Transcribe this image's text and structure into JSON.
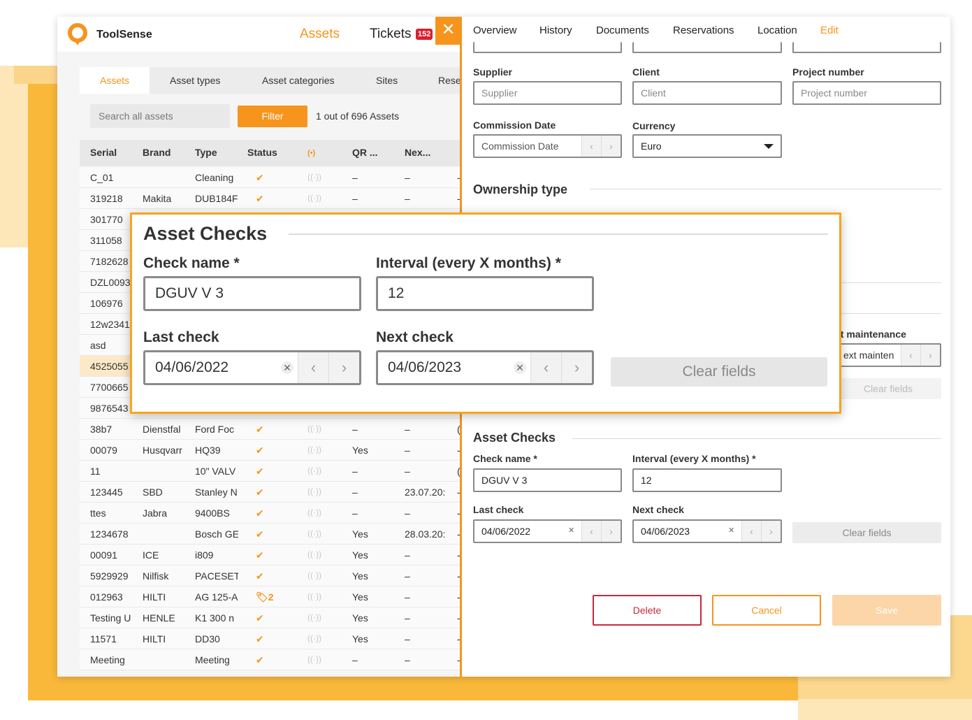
{
  "brand": {
    "name": "ToolSense"
  },
  "topnav": {
    "assets": "Assets",
    "tickets": "Tickets",
    "tickets_badge": "152"
  },
  "subtabs": {
    "assets": "Assets",
    "asset_types": "Asset types",
    "asset_categories": "Asset categories",
    "sites": "Sites",
    "reservations": "Rese"
  },
  "search": {
    "placeholder": "Search all assets"
  },
  "filter_label": "Filter",
  "count_text": "1 out of 696 Assets",
  "table": {
    "columns": [
      "Serial",
      "Brand",
      "Type",
      "Status",
      "(•)",
      "QR ...",
      "Nex..."
    ],
    "rows": [
      {
        "serial": "C_01",
        "brand": "",
        "type": "Cleaning",
        "status": "✔",
        "qr": "–",
        "next": "–",
        "last": "-"
      },
      {
        "serial": "319218",
        "brand": "Makita",
        "type": "DUB184F",
        "status": "✔",
        "qr": "–",
        "next": "–",
        "last": "-"
      },
      {
        "serial": "301770",
        "brand": "",
        "type": "",
        "status": "",
        "qr": "",
        "next": "",
        "last": ""
      },
      {
        "serial": "311058",
        "brand": "",
        "type": "",
        "status": "",
        "qr": "",
        "next": "",
        "last": ""
      },
      {
        "serial": "7182628",
        "brand": "",
        "type": "",
        "status": "",
        "qr": "",
        "next": "",
        "last": ""
      },
      {
        "serial": "DZL0093",
        "brand": "",
        "type": "",
        "status": "",
        "qr": "",
        "next": "",
        "last": ""
      },
      {
        "serial": "106976",
        "brand": "",
        "type": "",
        "status": "",
        "qr": "",
        "next": "",
        "last": ""
      },
      {
        "serial": "12w2341",
        "brand": "",
        "type": "",
        "status": "",
        "qr": "",
        "next": "",
        "last": ""
      },
      {
        "serial": "asd",
        "brand": "",
        "type": "",
        "status": "",
        "qr": "",
        "next": "",
        "last": ""
      },
      {
        "serial": "4525055",
        "brand": "",
        "type": "",
        "status": "",
        "qr": "",
        "next": "",
        "last": ""
      },
      {
        "serial": "7700665",
        "brand": "",
        "type": "",
        "status": "",
        "qr": "",
        "next": "",
        "last": ""
      },
      {
        "serial": "9876543",
        "brand": "",
        "type": "",
        "status": "",
        "qr": "",
        "next": "",
        "last": ""
      },
      {
        "serial": "38b7",
        "brand": "Dienstfal",
        "type": "Ford Foc",
        "status": "✔",
        "qr": "–",
        "next": "–",
        "last": "("
      },
      {
        "serial": "00079",
        "brand": "Husqvarr",
        "type": "HQ39",
        "status": "✔",
        "qr": "Yes",
        "next": "–",
        "last": "-"
      },
      {
        "serial": "11",
        "brand": "",
        "type": "10\" VALV",
        "status": "✔",
        "qr": "–",
        "next": "–",
        "last": "("
      },
      {
        "serial": "123445",
        "brand": "SBD",
        "type": "Stanley N",
        "status": "✔",
        "qr": "–",
        "next": "23.07.20:",
        "last": "-"
      },
      {
        "serial": "ttes",
        "brand": "Jabra",
        "type": "9400BS",
        "status": "✔",
        "qr": "–",
        "next": "–",
        "last": "-"
      },
      {
        "serial": "1234678",
        "brand": "",
        "type": "Bosch GE",
        "status": "✔",
        "qr": "Yes",
        "next": "28.03.20:",
        "last": "-"
      },
      {
        "serial": "00091",
        "brand": "ICE",
        "type": "i809",
        "status": "✔",
        "qr": "Yes",
        "next": "–",
        "last": "-"
      },
      {
        "serial": "5929929",
        "brand": "Nilfisk",
        "type": "PACESET",
        "status": "✔",
        "qr": "Yes",
        "next": "–",
        "last": "-"
      },
      {
        "serial": "012963",
        "brand": "HILTI",
        "type": "AG 125-A",
        "status": "🏷2",
        "qr": "Yes",
        "next": "–",
        "last": "-"
      },
      {
        "serial": "Testing U",
        "brand": "HENLE",
        "type": "K1 300 n",
        "status": "✔",
        "qr": "Yes",
        "next": "–",
        "last": "-"
      },
      {
        "serial": "11571",
        "brand": "HILTI",
        "type": "DD30",
        "status": "✔",
        "qr": "Yes",
        "next": "–",
        "last": "-"
      },
      {
        "serial": "Meeting",
        "brand": "",
        "type": "Meeting",
        "status": "✔",
        "qr": "–",
        "next": "–",
        "last": "-"
      }
    ]
  },
  "close_label": "✕",
  "panel": {
    "tabs": [
      "Overview",
      "History",
      "Documents",
      "Reservations",
      "Location",
      "Edit"
    ],
    "supplier_label": "Supplier",
    "supplier_placeholder": "Supplier",
    "client_label": "Client",
    "client_placeholder": "Client",
    "project_label": "Project number",
    "project_placeholder": "Project number",
    "commission_label": "Commission Date",
    "commission_placeholder": "Commission Date",
    "currency_label": "Currency",
    "currency_value": "Euro",
    "ownership_title": "Ownership type",
    "next_maint_label": "xt maintenance",
    "next_maint_placeholder": "ext mainten",
    "clear_fields": "Clear fields",
    "checks_title": "Asset Checks",
    "check_name_label": "Check name *",
    "check_name_value": "DGUV V 3",
    "interval_label": "Interval (every X months) *",
    "interval_value": "12",
    "last_check_label": "Last check",
    "last_check_value": "04/06/2022",
    "next_check_label": "Next check",
    "next_check_value": "04/06/2023",
    "delete": "Delete",
    "cancel": "Cancel",
    "save": "Save"
  },
  "colors": {
    "accent": "#f7941d",
    "danger": "#c8283a",
    "badge": "#d9202c"
  },
  "icons": {
    "close": "close-icon",
    "check": "checkmark-icon",
    "signal": "signal-off-icon",
    "tag": "tag-icon",
    "prev": "chevron-left-icon",
    "next": "chevron-right-icon",
    "clear": "clear-x-icon",
    "caret": "caret-down-icon"
  }
}
